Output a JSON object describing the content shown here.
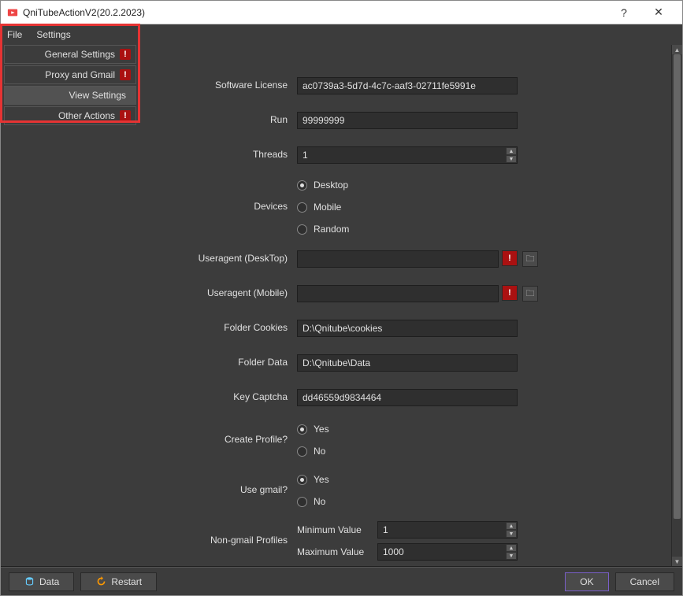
{
  "window": {
    "title": "QniTubeActionV2(20.2.2023)",
    "help": "?",
    "close": "✕"
  },
  "menubar": {
    "file": "File",
    "settings": "Settings"
  },
  "sidebar": {
    "items": [
      {
        "label": "General Settings",
        "alert": true
      },
      {
        "label": "Proxy and Gmail",
        "alert": true
      },
      {
        "label": "View Settings",
        "alert": false
      },
      {
        "label": "Other Actions",
        "alert": true
      }
    ],
    "alert_glyph": "!"
  },
  "form": {
    "software_license": {
      "label": "Software License",
      "value": "ac0739a3-5d7d-4c7c-aaf3-02711fe5991e"
    },
    "run": {
      "label": "Run",
      "value": "99999999"
    },
    "threads": {
      "label": "Threads",
      "value": "1"
    },
    "devices": {
      "label": "Devices",
      "opt1": "Desktop",
      "opt2": "Mobile",
      "opt3": "Random"
    },
    "ua_desktop": {
      "label": "Useragent (DeskTop)",
      "value": ""
    },
    "ua_mobile": {
      "label": "Useragent  (Mobile)",
      "value": ""
    },
    "folder_cookies": {
      "label": "Folder Cookies",
      "value": "D:\\Qnitube\\cookies"
    },
    "folder_data": {
      "label": "Folder Data",
      "value": "D:\\Qnitube\\Data"
    },
    "key_captcha": {
      "label": "Key Captcha",
      "value": "dd46559d9834464"
    },
    "create_profile": {
      "label": "Create Profile?",
      "yes": "Yes",
      "no": "No"
    },
    "use_gmail": {
      "label": "Use gmail?",
      "yes": "Yes",
      "no": "No"
    },
    "non_gmail": {
      "label": "Non-gmail Profiles",
      "min_label": "Minimum Value",
      "min_value": "1",
      "max_label": "Maximum Value",
      "max_value": "1000"
    },
    "alert_glyph": "!",
    "browse_glyph": "🗀"
  },
  "footer": {
    "data": "Data",
    "restart": "Restart",
    "ok": "OK",
    "cancel": "Cancel"
  }
}
